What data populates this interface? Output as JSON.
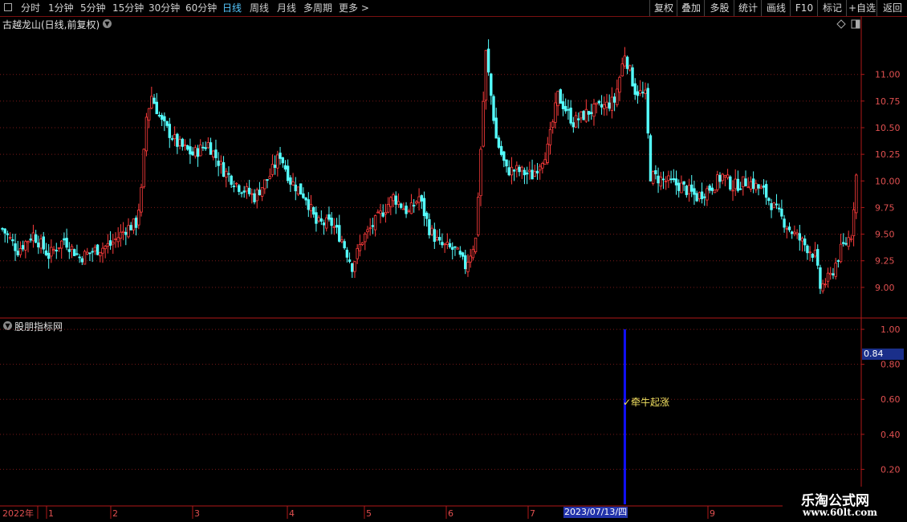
{
  "toolbar": {
    "periods": [
      "分时",
      "1分钟",
      "5分钟",
      "15分钟",
      "30分钟",
      "60分钟",
      "日线",
      "周线",
      "月线",
      "多周期",
      "更多 >"
    ],
    "active_period": "日线",
    "actions": [
      "复权",
      "叠加",
      "多股",
      "统计",
      "画线",
      "F10",
      "标记",
      "+自选",
      "返回"
    ]
  },
  "main_panel": {
    "title": "古越龙山(日线,前复权)"
  },
  "indicator_panel": {
    "title": "股朋指标网",
    "current_value": "0.84",
    "signal_label": "✓牵牛起涨"
  },
  "time_axis": {
    "year_label": "2022年",
    "month_labels": [
      "1",
      "2",
      "3",
      "4",
      "5",
      "6",
      "7",
      "9"
    ],
    "highlight_date": "2023/07/13/四"
  },
  "watermark": {
    "line1": "乐淘公式网",
    "line2": "www.60lt.com"
  },
  "colors": {
    "up": "#ff3c3c",
    "down": "#54ffff",
    "axis": "#b01818",
    "signal": "#1010ff",
    "active": "#56c8ff"
  },
  "chart_data": [
    {
      "type": "candlestick",
      "title": "古越龙山(日线,前复权)",
      "y_ticks": [
        9.0,
        9.25,
        9.5,
        9.75,
        10.0,
        10.25,
        10.5,
        10.75,
        11.0
      ],
      "ylim": [
        8.72,
        11.42
      ],
      "series_close_path": [
        [
          0,
          9.55
        ],
        [
          6,
          9.35
        ],
        [
          12,
          9.5
        ],
        [
          18,
          9.3
        ],
        [
          24,
          9.45
        ],
        [
          30,
          9.28
        ],
        [
          36,
          9.35
        ],
        [
          42,
          9.4
        ],
        [
          48,
          9.55
        ],
        [
          52,
          9.6
        ],
        [
          54,
          9.9
        ],
        [
          56,
          10.6
        ],
        [
          58,
          10.8
        ],
        [
          62,
          10.55
        ],
        [
          68,
          10.35
        ],
        [
          74,
          10.25
        ],
        [
          80,
          10.35
        ],
        [
          86,
          10.1
        ],
        [
          92,
          9.95
        ],
        [
          98,
          9.85
        ],
        [
          104,
          10.05
        ],
        [
          108,
          10.25
        ],
        [
          112,
          10.0
        ],
        [
          118,
          9.85
        ],
        [
          122,
          9.6
        ],
        [
          128,
          9.6
        ],
        [
          132,
          9.45
        ],
        [
          136,
          9.2
        ],
        [
          140,
          9.45
        ],
        [
          146,
          9.65
        ],
        [
          152,
          9.85
        ],
        [
          158,
          9.7
        ],
        [
          162,
          9.85
        ],
        [
          166,
          9.55
        ],
        [
          170,
          9.4
        ],
        [
          176,
          9.35
        ],
        [
          180,
          9.2
        ],
        [
          184,
          9.45
        ],
        [
          186,
          10.3
        ],
        [
          188,
          11.2
        ],
        [
          192,
          10.4
        ],
        [
          196,
          10.1
        ],
        [
          200,
          10.1
        ],
        [
          206,
          10.05
        ],
        [
          212,
          10.3
        ],
        [
          216,
          10.8
        ],
        [
          222,
          10.55
        ],
        [
          228,
          10.65
        ],
        [
          234,
          10.7
        ],
        [
          238,
          10.75
        ],
        [
          242,
          11.2
        ],
        [
          246,
          10.85
        ],
        [
          250,
          10.8
        ],
        [
          252,
          10.05
        ],
        [
          258,
          10.0
        ],
        [
          264,
          9.95
        ],
        [
          270,
          9.85
        ],
        [
          276,
          9.95
        ],
        [
          280,
          10.05
        ],
        [
          284,
          9.95
        ],
        [
          290,
          10.0
        ],
        [
          296,
          9.9
        ],
        [
          300,
          9.75
        ],
        [
          306,
          9.55
        ],
        [
          310,
          9.45
        ],
        [
          316,
          9.3
        ],
        [
          318,
          9.0
        ],
        [
          322,
          9.1
        ],
        [
          326,
          9.35
        ],
        [
          330,
          9.5
        ],
        [
          332,
          10.05
        ]
      ]
    },
    {
      "type": "bar",
      "title": "股朋指标网",
      "y_ticks": [
        0.2,
        0.4,
        0.6,
        0.8,
        1.0
      ],
      "ylim": [
        0.0,
        1.06
      ],
      "signals": [
        {
          "index": 242,
          "value": 1.0,
          "label": "✓牵牛起涨"
        }
      ]
    }
  ]
}
